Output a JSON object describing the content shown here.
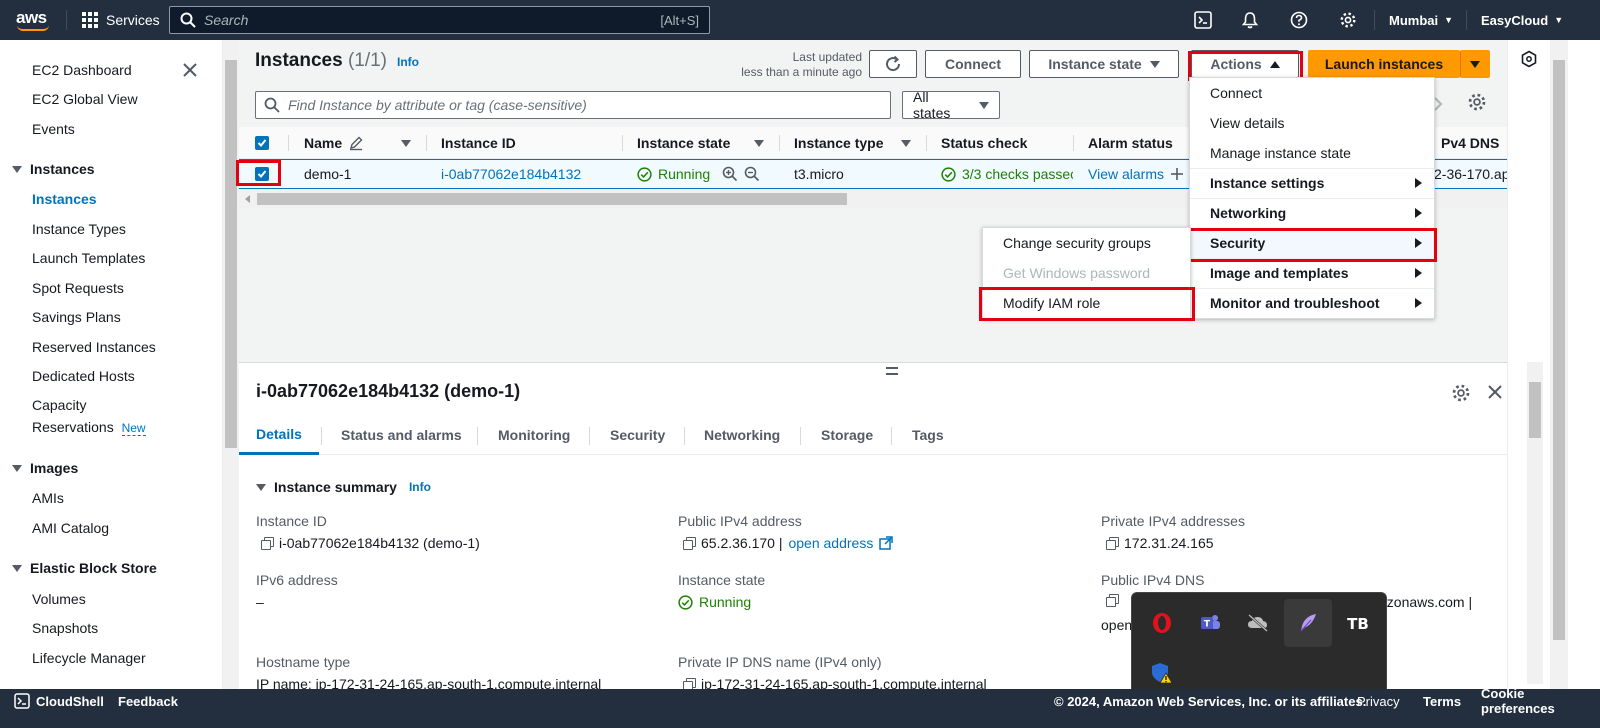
{
  "topnav": {
    "logo": "aws",
    "services": "Services",
    "search_placeholder": "Search",
    "search_hint": "[Alt+S]",
    "region": "Mumbai",
    "account": "EasyCloud"
  },
  "sidebar": {
    "items": [
      "EC2 Dashboard",
      "EC2 Global View",
      "Events"
    ],
    "sections": [
      {
        "title": "Instances",
        "items": [
          "Instances",
          "Instance Types",
          "Launch Templates",
          "Spot Requests",
          "Savings Plans",
          "Reserved Instances",
          "Dedicated Hosts",
          "Capacity",
          "Reservations"
        ]
      },
      {
        "title": "Images",
        "items": [
          "AMIs",
          "AMI Catalog"
        ]
      },
      {
        "title": "Elastic Block Store",
        "items": [
          "Volumes",
          "Snapshots",
          "Lifecycle Manager"
        ]
      }
    ],
    "new_badge": "New"
  },
  "header": {
    "title": "Instances",
    "count": "(1/1)",
    "info": "Info",
    "last_updated_1": "Last updated",
    "last_updated_2": "less than a minute ago",
    "connect": "Connect",
    "instance_state": "Instance state",
    "actions": "Actions",
    "launch": "Launch instances"
  },
  "filter": {
    "placeholder": "Find Instance by attribute or tag (case-sensitive)",
    "states": "All states"
  },
  "table": {
    "columns": [
      "Name",
      "Instance ID",
      "Instance state",
      "Instance type",
      "Status check",
      "Alarm status",
      "Pv4 DNS"
    ],
    "row": {
      "name": "demo-1",
      "instance_id": "i-0ab77062e184b4132",
      "state": "Running",
      "type": "t3.micro",
      "status": "3/3 checks passec",
      "alarm": "View alarms",
      "dns": "2-36-170.ap"
    }
  },
  "actions_menu": {
    "items": [
      "Connect",
      "View details",
      "Manage instance state",
      "Instance settings",
      "Networking",
      "Security",
      "Image and templates",
      "Monitor and troubleshoot"
    ]
  },
  "security_submenu": {
    "items": [
      "Change security groups",
      "Get Windows password",
      "Modify IAM role"
    ]
  },
  "details": {
    "title": "i-0ab77062e184b4132 (demo-1)",
    "tabs": [
      "Details",
      "Status and alarms",
      "Monitoring",
      "Security",
      "Networking",
      "Storage",
      "Tags"
    ],
    "summary": "Instance summary",
    "info": "Info",
    "fields": {
      "instance_id_label": "Instance ID",
      "instance_id_value": "i-0ab77062e184b4132 (demo-1)",
      "public_ipv4_label": "Public IPv4 address",
      "public_ipv4_value": "65.2.36.170 |",
      "open_address": "open address",
      "private_ipv4_label": "Private IPv4 addresses",
      "private_ipv4_value": "172.31.24.165",
      "ipv6_label": "IPv6 address",
      "ipv6_value": "–",
      "state_label": "Instance state",
      "state_value": "Running",
      "public_dns_label": "Public IPv4 DNS",
      "public_dns_value_end": "azonaws.com |",
      "public_dns_open": "open",
      "hostname_label": "Hostname type",
      "hostname_value": "IP name: ip-172-31-24-165.ap-south-1.compute.internal",
      "private_dns_label": "Private IP DNS name (IPv4 only)",
      "private_dns_value": "ip-172-31-24-165.ap-south-1.compute.internal"
    }
  },
  "footer": {
    "cloudshell": "CloudShell",
    "feedback": "Feedback",
    "copyright": "© 2024, Amazon Web Services, Inc. or its affiliates.",
    "privacy": "Privacy",
    "terms": "Terms",
    "cookies": "Cookie preferences"
  },
  "colors": {
    "nav": "#232f3e",
    "link": "#0073bb",
    "orange": "#ff9900",
    "green": "#1d8102",
    "highlight": "#e3000f"
  }
}
